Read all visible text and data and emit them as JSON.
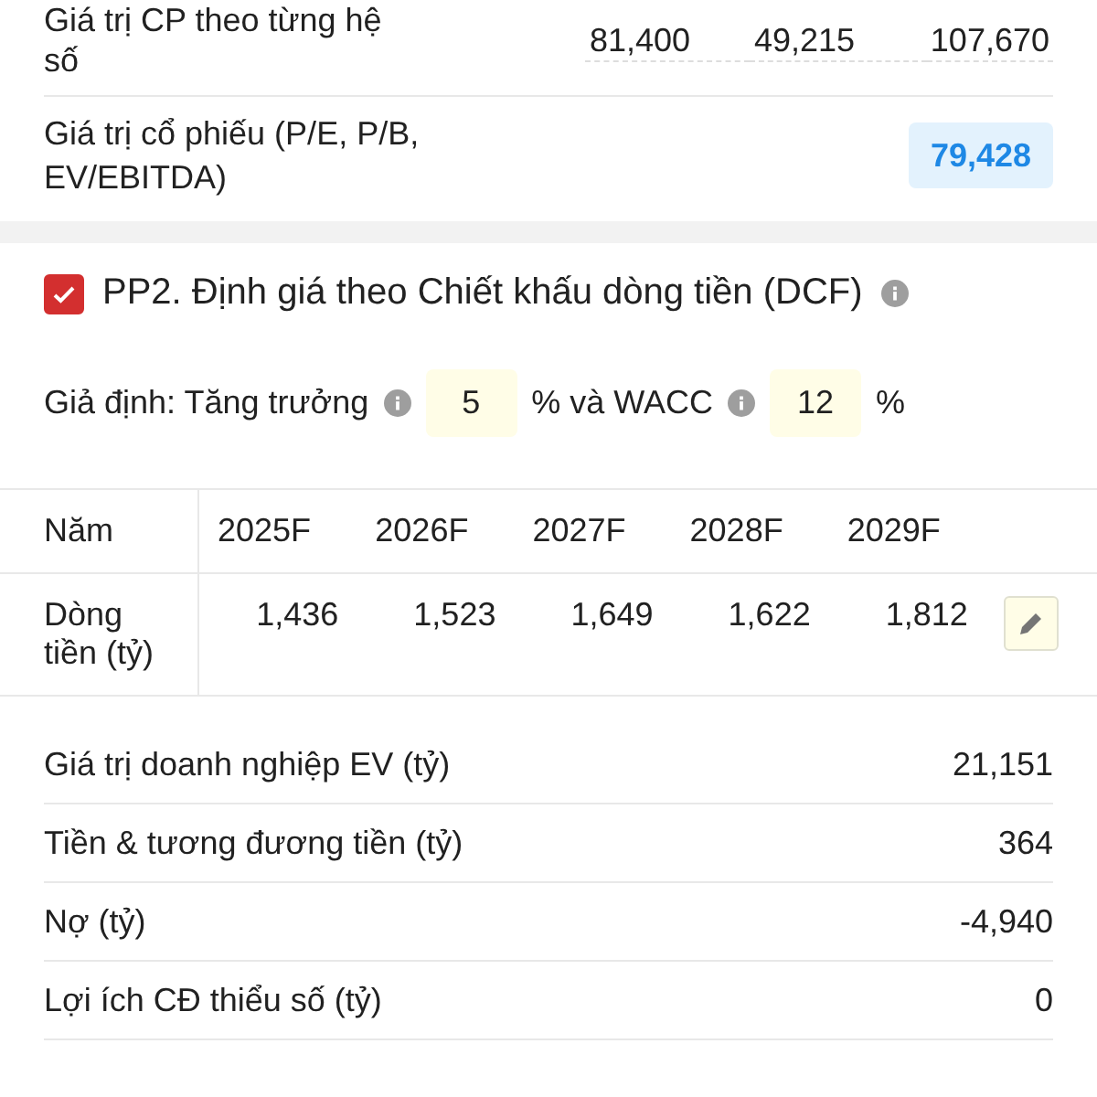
{
  "top_rows": [
    {
      "label": "Giá trị CP theo từng hệ số",
      "values": [
        "81,400",
        "49,215",
        "107,670"
      ]
    },
    {
      "label": "Giá trị cổ phiếu (P/E, P/B, EV/EBITDA)",
      "result": "79,428"
    }
  ],
  "dcf": {
    "checked": true,
    "title": "PP2. Định giá theo Chiết khấu dòng tiền (DCF)",
    "assumption": {
      "label": "Giả định: Tăng trưởng",
      "growth": "5",
      "mid": "% và WACC",
      "wacc": "12",
      "unit": "%"
    },
    "table": {
      "header": "Năm",
      "years": [
        "2025F",
        "2026F",
        "2027F",
        "2028F",
        "2029F"
      ],
      "row_label": "Dòng tiền (tỷ)",
      "values": [
        "1,436",
        "1,523",
        "1,649",
        "1,622",
        "1,812"
      ]
    },
    "summary": [
      {
        "label": "Giá trị doanh nghiệp EV (tỷ)",
        "value": "21,151"
      },
      {
        "label": "Tiền & tương đương tiền (tỷ)",
        "value": "364"
      },
      {
        "label": "Nợ (tỷ)",
        "value": "-4,940"
      },
      {
        "label": "Lợi ích CĐ thiểu số (tỷ)",
        "value": "0"
      }
    ]
  }
}
